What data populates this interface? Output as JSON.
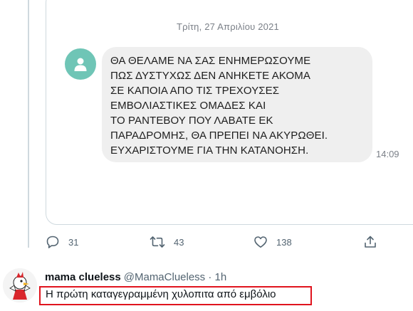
{
  "embedded_screenshot": {
    "date": "Τρίτη, 27 Απριλίου 2021",
    "sender_icon": "person-icon",
    "message_lines": [
      "ΘΑ ΘΕΛΑΜΕ ΝΑ ΣΑΣ ΕΝΗΜΕΡΩΣΟΥΜΕ",
      "ΠΩΣ ΔΥΣΤΥΧΩΣ ΔΕΝ ΑΝΗΚΕΤΕ ΑΚΟΜΑ",
      "ΣΕ ΚΑΠΟΙΑ ΑΠΟ ΤΙΣ ΤΡΕΧΟΥΣΕΣ",
      "ΕΜΒΟΛΙΑΣΤΙΚΕΣ ΟΜΑΔΕΣ ΚΑΙ",
      "ΤΟ ΡΑΝΤΕΒΟΥ ΠΟΥ ΛΑΒΑΤΕ ΕΚ",
      "ΠΑΡΑΔΡΟΜΗΣ, ΘΑ ΠΡΕΠΕΙ ΝΑ ΑΚΥΡΩΘΕΙ.",
      "ΕΥΧΑΡΙΣΤΟΥΜΕ ΓΙΑ ΤΗΝ ΚΑΤΑΝΟΗΣΗ."
    ],
    "time": "14:09"
  },
  "actions": {
    "replies": "31",
    "retweets": "43",
    "likes": "138",
    "icons": [
      "reply-icon",
      "retweet-icon",
      "like-icon",
      "share-icon"
    ]
  },
  "reply_tweet": {
    "author_name": "mama clueless",
    "author_handle": "@MamaClueless · 1h",
    "text": "Η πρώτη καταγεγραμμένη χυλοπιτα από εμβόλιο"
  },
  "colors": {
    "link_accent": "#1d9bf0",
    "highlight_border": "#e0141e",
    "sender_avatar": "#6fc5b6"
  }
}
